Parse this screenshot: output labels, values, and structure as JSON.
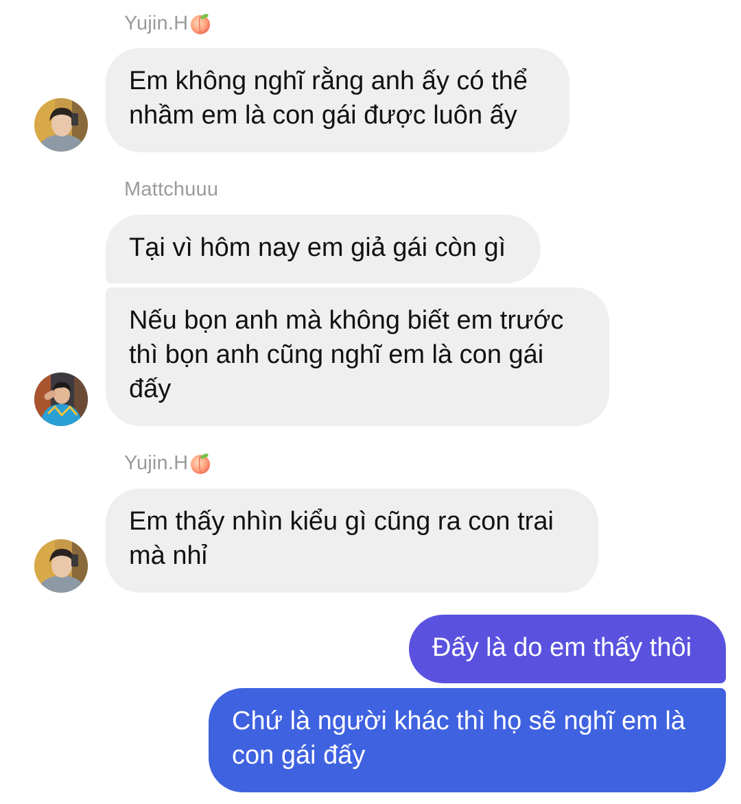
{
  "messages": [
    {
      "sender": "Yujin.H",
      "text": "Em không nghĩ rằng anh ấy có thể nhầm em là con gái được luôn ấy"
    },
    {
      "sender": "Mattchuuu",
      "text": "Tại vì hôm nay em giả gái còn gì"
    },
    {
      "text": "Nếu bọn anh mà không biết em trước thì bọn anh cũng nghĩ em là con gái đấy"
    },
    {
      "sender": "Yujin.H",
      "text": "Em thấy nhìn kiểu gì cũng ra con trai mà nhỉ"
    },
    {
      "text": "Đấy là do em thấy thôi"
    },
    {
      "text": "Chứ là người khác thì họ sẽ nghĩ em là con gái đấy"
    }
  ],
  "senders": {
    "yujin_1": "Yujin.H",
    "matt": "Mattchuuu",
    "yujin_2": "Yujin.H"
  },
  "icons": {
    "peach": "peach-emoji-icon"
  },
  "colors": {
    "incoming_bubble": "#efefef",
    "outgoing_top": "#5b4fe0",
    "outgoing_bottom": "#3f62e0",
    "sender_name": "#9a9a9a"
  }
}
